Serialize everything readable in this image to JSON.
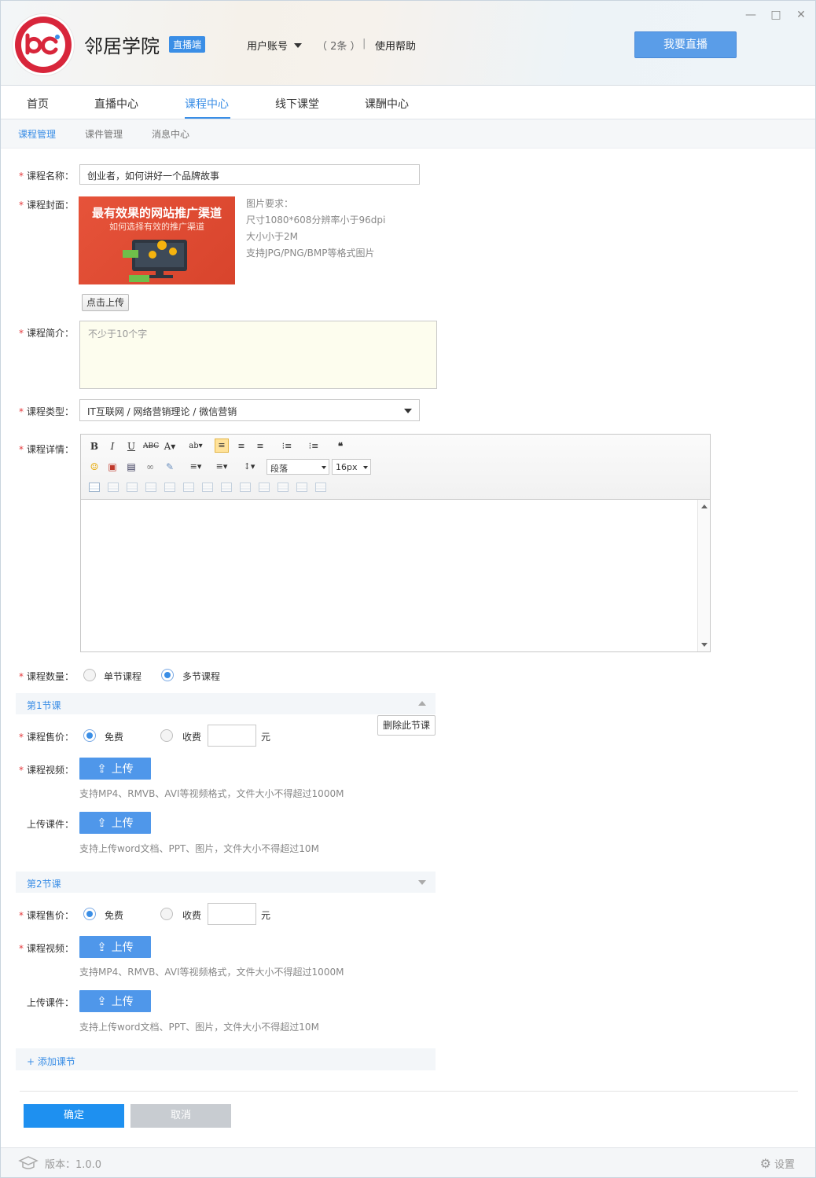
{
  "app": {
    "name": "邻居学院",
    "badge": "直播端"
  },
  "header": {
    "user_menu": "用户账号",
    "count": "（ 2条 ）",
    "separator": "|",
    "help": "使用帮助",
    "live_button": "我要直播"
  },
  "window_controls": {
    "minimize": "—",
    "maximize": "□",
    "close": "✕"
  },
  "tabs": [
    "首页",
    "直播中心",
    "课程中心",
    "线下课堂",
    "课酬中心"
  ],
  "active_tab": "课程中心",
  "subtabs": [
    "课程管理",
    "课件管理",
    "消息中心"
  ],
  "form": {
    "name_label": "课程名称：",
    "name_value": "创业者，如何讲好一个品牌故事",
    "cover_label": "课程封面：",
    "cover_title": "最有效果的网站推广渠道",
    "cover_subtitle": "如何选择有效的推广渠道",
    "cover_req_title": "图片要求：",
    "cover_req_1": "尺寸1080*608分辨率小于96dpi",
    "cover_req_2": "大小小于2M",
    "cover_req_3": "支持JPG/PNG/BMP等格式图片",
    "upload_cover_button": "点击上传",
    "intro_label": "课程简介：",
    "intro_placeholder": "不少于10个字",
    "type_label": "课程类型：",
    "type_value": "IT互联网 / 网络营销理论 / 微信营销",
    "detail_label": "课程详情：",
    "editor": {
      "paragraph": "段落",
      "font_size": "16px"
    },
    "quantity_label": "课程数量：",
    "quantity_options": [
      "单节课程",
      "多节课程"
    ],
    "quantity_selected": "多节课程"
  },
  "lessons": [
    {
      "title": "第1节课",
      "price_label": "课程售价：",
      "free": "免费",
      "paid": "收费",
      "unit": "元",
      "video_label": "课程视频：",
      "upload": "上传",
      "video_hint": "支持MP4、RMVB、AVI等视频格式，文件大小不得超过1000M",
      "courseware_label": "上传课件：",
      "courseware_hint": "支持上传word文档、PPT、图片，文件大小不得超过10M",
      "delete": "删除此节课",
      "selected": "免费"
    },
    {
      "title": "第2节课",
      "price_label": "课程售价：",
      "free": "免费",
      "paid": "收费",
      "unit": "元",
      "video_label": "课程视频：",
      "upload": "上传",
      "video_hint": "支持MP4、RMVB、AVI等视频格式，文件大小不得超过1000M",
      "courseware_label": "上传课件：",
      "courseware_hint": "支持上传word文档、PPT、图片，文件大小不得超过10M",
      "selected": "免费"
    }
  ],
  "add_lesson": "+ 添加课节",
  "actions": {
    "confirm": "确定",
    "cancel": "取消"
  },
  "footer": {
    "version": "版本：1.0.0",
    "settings": "设置"
  },
  "colors": {
    "accent": "#3a8ee6",
    "required": "#e4393c",
    "confirm": "#1e90f0",
    "logo": "#d8263b"
  }
}
